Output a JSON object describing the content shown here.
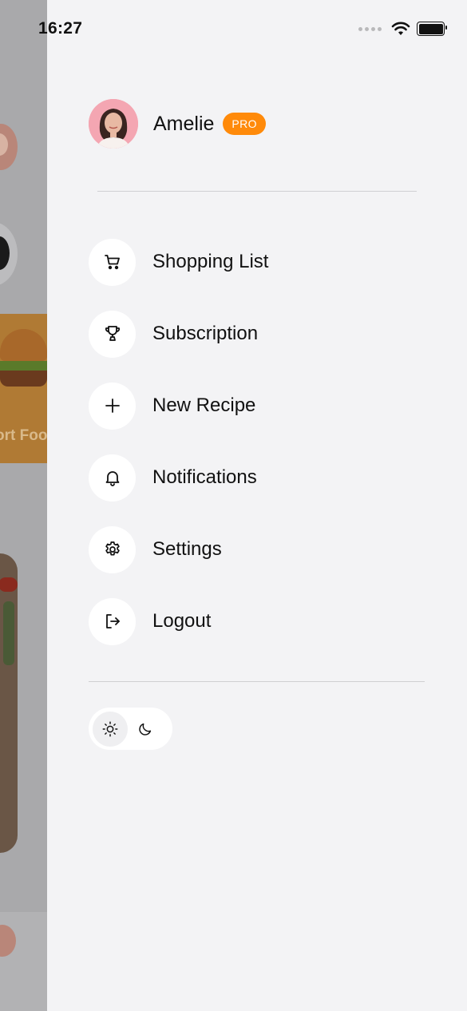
{
  "status_bar": {
    "time": "16:27"
  },
  "background_app": {
    "category_label": "ort Foo"
  },
  "profile": {
    "name": "Amelie",
    "badge": "PRO"
  },
  "menu": {
    "items": [
      {
        "label": "Shopping List",
        "icon": "cart-icon"
      },
      {
        "label": "Subscription",
        "icon": "trophy-icon"
      },
      {
        "label": "New Recipe",
        "icon": "plus-icon"
      },
      {
        "label": "Notifications",
        "icon": "bell-icon"
      },
      {
        "label": "Settings",
        "icon": "gear-icon"
      },
      {
        "label": "Logout",
        "icon": "logout-icon"
      }
    ]
  },
  "theme_toggle": {
    "selected": "light",
    "options": [
      "sun-icon",
      "moon-icon"
    ]
  },
  "colors": {
    "accent": "#ff8a0a",
    "drawer_bg": "#f3f3f5",
    "icon_circle": "#ffffff"
  }
}
